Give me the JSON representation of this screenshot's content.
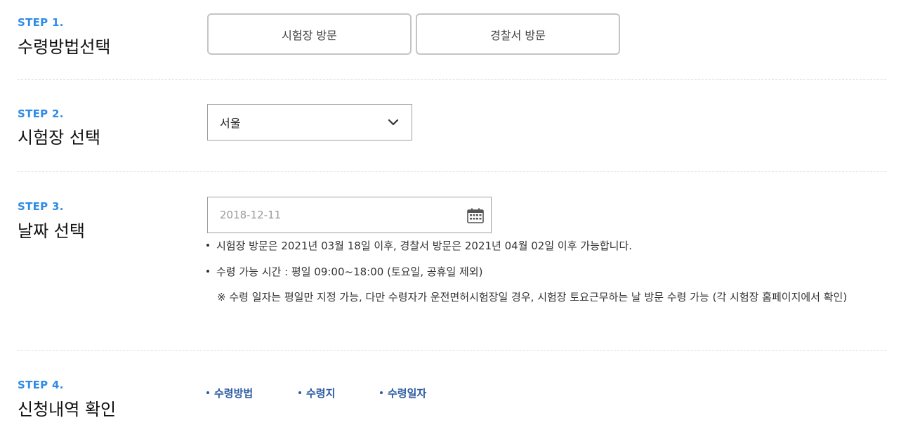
{
  "steps": [
    {
      "num": "STEP 1.",
      "title": "수령방법선택"
    },
    {
      "num": "STEP 2.",
      "title": "시험장 선택"
    },
    {
      "num": "STEP 3.",
      "title": "날짜 선택"
    },
    {
      "num": "STEP 4.",
      "title": "신청내역 확인"
    }
  ],
  "method": {
    "options": [
      "시험장 방문",
      "경찰서 방문"
    ]
  },
  "site_select": {
    "value": "서울",
    "icon": "chevron-down-icon"
  },
  "date": {
    "value": "2018-12-11",
    "icon": "calendar-icon"
  },
  "notes": [
    "시험장 방문은 2021년 03월 18일 이후, 경찰서 방문은 2021년 04월 02일 이후 가능합니다.",
    "수령 가능 시간 : 평일 09:00~18:00 (토요일, 공휴일 제외)"
  ],
  "note_sub": "※ 수령 일자는 평일만 지정 가능, 다만 수령자가 운전면허시험장일 경우, 시험장 토요근무하는 날 방문 수령 가능 (각 시험장 홈페이지에서 확인)",
  "summary": {
    "items": [
      "수령방법",
      "수령지",
      "수령일자"
    ]
  },
  "colors": {
    "step_accent": "#2f8be6",
    "summary_accent": "#2b5aa0",
    "border": "#9e9e9e"
  }
}
